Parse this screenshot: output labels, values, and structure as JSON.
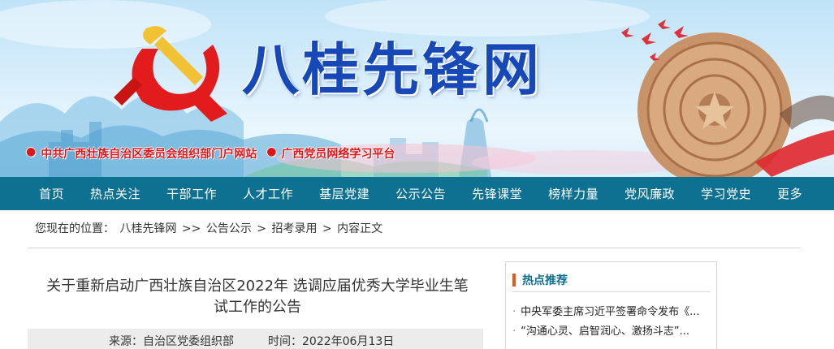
{
  "banner": {
    "title": "八桂先锋网",
    "links": [
      {
        "label": "中共广西壮族自治区委员会组织部门户网站"
      },
      {
        "label": "广西党员网络学习平台"
      }
    ],
    "bullet": "●",
    "colors": {
      "title": "#1648b8",
      "emblem": "#e21c1c",
      "links": "#e0151a",
      "sky": "#bfe3f7"
    }
  },
  "nav": {
    "items": [
      "首页",
      "热点关注",
      "干部工作",
      "人才工作",
      "基层党建",
      "公示公告",
      "先锋课堂",
      "榜样力量",
      "党风廉政",
      "学习党史",
      "更多"
    ],
    "color": "#0f7191"
  },
  "breadcrumb": {
    "prefix": "您现在的位置：",
    "items": [
      "八桂先锋网",
      ">>",
      "公告公示",
      ">",
      "招考录用",
      ">",
      "内容正文"
    ]
  },
  "article": {
    "title_line1": "关于重新启动广西壮族自治区2022年 选调应届优秀大学毕业生笔",
    "title_line2": "试工作的公告",
    "source_label": "来源：自治区党委组织部",
    "time_label": "时间：2022年06月13日"
  },
  "sidebar": {
    "heading": "热点推荐",
    "bullet": "·",
    "items": [
      "中央军委主席习近平签署命令发布《...",
      "“沟通心灵、启智润心、激扬斗志”..."
    ],
    "accent": "#e8581a"
  }
}
